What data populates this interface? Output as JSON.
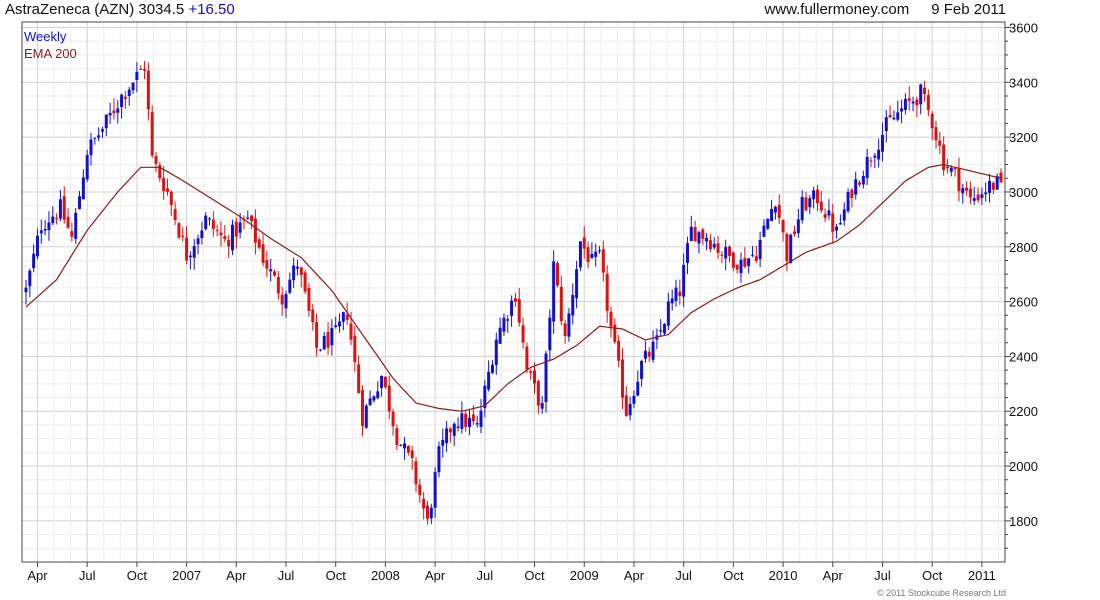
{
  "header": {
    "symbol": "AstraZeneca (AZN)",
    "price": "3034.5",
    "change": "+16.50",
    "site": "www.fullermoney.com",
    "date": "9 Feb 2011"
  },
  "footer": {
    "copyright": "© 2011 Stockcube Research Ltd"
  },
  "colors": {
    "up": "#1111cc",
    "down": "#dd1111",
    "ema": "#8b1a1a",
    "grid": "#d6d6d6",
    "weekly": "#1111cc"
  },
  "chart_data": {
    "type": "candlestick",
    "ylim": [
      1650,
      3620
    ],
    "yticks": [
      1800,
      2000,
      2200,
      2400,
      2600,
      2800,
      3000,
      3200,
      3400,
      3600
    ],
    "xlim": [
      0,
      255
    ],
    "xticks": [
      {
        "x": 3,
        "label": "Apr"
      },
      {
        "x": 16,
        "label": "Jul"
      },
      {
        "x": 29,
        "label": "Oct"
      },
      {
        "x": 42,
        "label": "2007"
      },
      {
        "x": 55,
        "label": "Apr"
      },
      {
        "x": 68,
        "label": "Jul"
      },
      {
        "x": 81,
        "label": "Oct"
      },
      {
        "x": 94,
        "label": "2008"
      },
      {
        "x": 107,
        "label": "Apr"
      },
      {
        "x": 120,
        "label": "Jul"
      },
      {
        "x": 133,
        "label": "Oct"
      },
      {
        "x": 146,
        "label": "2009"
      },
      {
        "x": 159,
        "label": "Apr"
      },
      {
        "x": 172,
        "label": "Jul"
      },
      {
        "x": 185,
        "label": "Oct"
      },
      {
        "x": 198,
        "label": "2010"
      },
      {
        "x": 211,
        "label": "Apr"
      },
      {
        "x": 224,
        "label": "Jul"
      },
      {
        "x": 237,
        "label": "Oct"
      },
      {
        "x": 250,
        "label": "2011"
      }
    ],
    "series": [
      {
        "name": "Weekly"
      },
      {
        "name": "EMA 200"
      }
    ],
    "close_anchors": [
      [
        0,
        2640
      ],
      [
        4,
        2880
      ],
      [
        9,
        2940
      ],
      [
        12,
        2830
      ],
      [
        16,
        3150
      ],
      [
        20,
        3230
      ],
      [
        25,
        3350
      ],
      [
        31,
        3460
      ],
      [
        33,
        3120
      ],
      [
        37,
        3000
      ],
      [
        42,
        2770
      ],
      [
        47,
        2900
      ],
      [
        52,
        2820
      ],
      [
        58,
        2900
      ],
      [
        62,
        2760
      ],
      [
        67,
        2620
      ],
      [
        71,
        2740
      ],
      [
        76,
        2430
      ],
      [
        81,
        2480
      ],
      [
        84,
        2560
      ],
      [
        88,
        2180
      ],
      [
        93,
        2330
      ],
      [
        97,
        2110
      ],
      [
        101,
        2000
      ],
      [
        105,
        1790
      ],
      [
        108,
        2040
      ],
      [
        112,
        2170
      ],
      [
        116,
        2160
      ],
      [
        118,
        2140
      ],
      [
        123,
        2470
      ],
      [
        128,
        2630
      ],
      [
        131,
        2350
      ],
      [
        135,
        2210
      ],
      [
        138,
        2730
      ],
      [
        141,
        2460
      ],
      [
        145,
        2820
      ],
      [
        148,
        2740
      ],
      [
        150,
        2760
      ],
      [
        153,
        2500
      ],
      [
        157,
        2200
      ],
      [
        161,
        2370
      ],
      [
        165,
        2450
      ],
      [
        168,
        2580
      ],
      [
        171,
        2640
      ],
      [
        174,
        2860
      ],
      [
        178,
        2840
      ],
      [
        182,
        2780
      ],
      [
        187,
        2740
      ],
      [
        191,
        2780
      ],
      [
        196,
        2980
      ],
      [
        199,
        2770
      ],
      [
        203,
        2950
      ],
      [
        207,
        2980
      ],
      [
        212,
        2850
      ],
      [
        216,
        3010
      ],
      [
        220,
        3110
      ],
      [
        225,
        3240
      ],
      [
        229,
        3300
      ],
      [
        234,
        3360
      ],
      [
        237,
        3260
      ],
      [
        240,
        3110
      ],
      [
        243,
        3060
      ],
      [
        247,
        2970
      ],
      [
        252,
        3020
      ],
      [
        255,
        3034.5
      ]
    ],
    "ema_200": [
      [
        0,
        2580
      ],
      [
        8,
        2680
      ],
      [
        16,
        2860
      ],
      [
        24,
        3000
      ],
      [
        30,
        3090
      ],
      [
        35,
        3090
      ],
      [
        40,
        3050
      ],
      [
        48,
        2980
      ],
      [
        56,
        2910
      ],
      [
        64,
        2830
      ],
      [
        72,
        2760
      ],
      [
        80,
        2640
      ],
      [
        88,
        2480
      ],
      [
        96,
        2320
      ],
      [
        102,
        2230
      ],
      [
        108,
        2210
      ],
      [
        114,
        2200
      ],
      [
        120,
        2220
      ],
      [
        126,
        2300
      ],
      [
        132,
        2360
      ],
      [
        138,
        2390
      ],
      [
        144,
        2440
      ],
      [
        150,
        2510
      ],
      [
        156,
        2500
      ],
      [
        162,
        2460
      ],
      [
        168,
        2480
      ],
      [
        174,
        2560
      ],
      [
        180,
        2610
      ],
      [
        186,
        2650
      ],
      [
        192,
        2680
      ],
      [
        198,
        2730
      ],
      [
        204,
        2780
      ],
      [
        212,
        2820
      ],
      [
        218,
        2880
      ],
      [
        224,
        2960
      ],
      [
        230,
        3040
      ],
      [
        236,
        3090
      ],
      [
        240,
        3100
      ],
      [
        246,
        3080
      ],
      [
        252,
        3060
      ],
      [
        255,
        3050
      ]
    ]
  }
}
